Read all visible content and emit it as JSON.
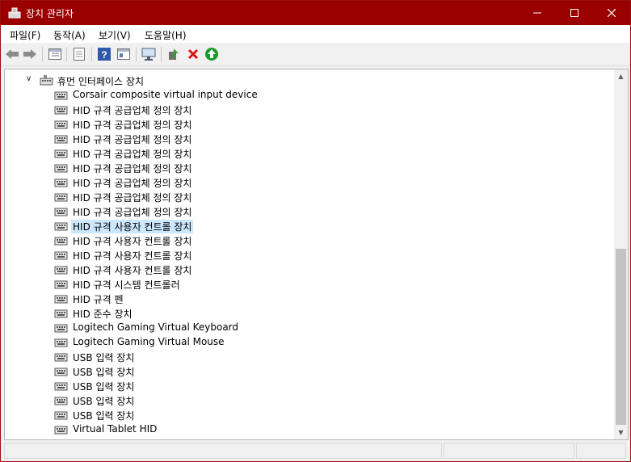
{
  "window": {
    "title": "장치 관리자"
  },
  "menu": [
    "파일(F)",
    "동작(A)",
    "보기(V)",
    "도움말(H)"
  ],
  "toolbar_icons": [
    "back-icon",
    "forward-icon",
    "properties-list-icon",
    "page-icon",
    "help-icon",
    "view-icon",
    "monitor-icon",
    "update-driver-icon",
    "uninstall-icon",
    "scan-hardware-icon"
  ],
  "tree": {
    "category": "휴먼 인터페이스 장치",
    "devices": [
      "Corsair composite virtual input device",
      "HID 규격 공급업체 정의 장치",
      "HID 규격 공급업체 정의 장치",
      "HID 규격 공급업체 정의 장치",
      "HID 규격 공급업체 정의 장치",
      "HID 규격 공급업체 정의 장치",
      "HID 규격 공급업체 정의 장치",
      "HID 규격 공급업체 정의 장치",
      "HID 규격 공급업체 정의 장치",
      "HID 규격 사용자 컨트롤 장치",
      "HID 규격 사용자 컨트롤 장치",
      "HID 규격 사용자 컨트롤 장치",
      "HID 규격 사용자 컨트롤 장치",
      "HID 규격 시스템 컨트롤러",
      "HID 규격 펜",
      "HID 준수 장치",
      "Logitech Gaming Virtual Keyboard",
      "Logitech Gaming Virtual Mouse",
      "USB 입력 장치",
      "USB 입력 장치",
      "USB 입력 장치",
      "USB 입력 장치",
      "USB 입력 장치",
      "Virtual Tablet HID"
    ],
    "selected_index": 9
  },
  "colors": {
    "titlebar": "#9b0000",
    "selection": "#cce8ff"
  }
}
